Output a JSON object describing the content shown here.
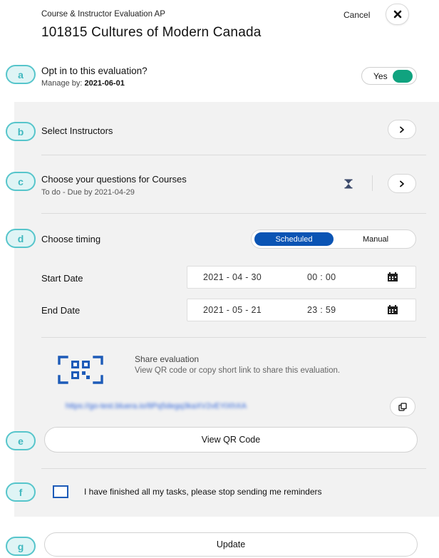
{
  "header": {
    "subtitle": "Course & Instructor Evaluation AP",
    "title": "101815 Cultures of Modern Canada",
    "cancel_label": "Cancel"
  },
  "badges": [
    "a",
    "b",
    "c",
    "d",
    "e",
    "f",
    "g"
  ],
  "optin": {
    "label": "Opt in to this evaluation?",
    "manage_prefix": "Manage by:",
    "manage_date": "2021-06-01",
    "toggle_label": "Yes",
    "toggle_on": true
  },
  "instructors": {
    "label": "Select Instructors"
  },
  "questions": {
    "label": "Choose your questions for Courses",
    "status": "To do - Due by 2021-04-29"
  },
  "timing": {
    "label": "Choose timing",
    "options": [
      "Scheduled",
      "Manual"
    ],
    "selected": "Scheduled",
    "start_label": "Start Date",
    "start_date": "2021 - 04 - 30",
    "start_time": "00 : 00",
    "end_label": "End Date",
    "end_date": "2021 - 05 - 21",
    "end_time": "23 : 59"
  },
  "share": {
    "title": "Share evaluation",
    "description": "View QR code or copy short link to share this evaluation.",
    "short_link": "https://go-test.bluera.io/8Pq5degq3kaXV2vEYiXhXA",
    "view_qr_label": "View QR Code"
  },
  "reminder": {
    "label": "I have finished all my tasks, please stop sending me reminders",
    "checked": false
  },
  "footer": {
    "update_label": "Update"
  },
  "colors": {
    "accent_teal": "#56c5cb",
    "toggle_green": "#10a37f",
    "primary_blue": "#0a54b4",
    "panel_gray": "#f2f2f2"
  },
  "icons": {
    "close": "close-icon",
    "chevron": "chevron-right-icon",
    "hourglass": "hourglass-icon",
    "calendar": "calendar-icon",
    "qr": "qr-code-icon",
    "copy": "copy-icon"
  }
}
